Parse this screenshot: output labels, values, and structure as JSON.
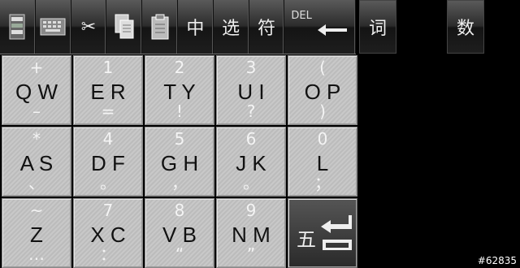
{
  "toolbar": {
    "buttons": [
      {
        "name": "select-all-icon",
        "label": ""
      },
      {
        "name": "keyboard-icon",
        "label": ""
      },
      {
        "name": "cut-icon",
        "label": "✂"
      },
      {
        "name": "copy-icon",
        "label": ""
      },
      {
        "name": "paste-icon",
        "label": ""
      },
      {
        "name": "chinese-mode-button",
        "label": "中"
      },
      {
        "name": "select-button",
        "label": "选"
      },
      {
        "name": "symbol-button",
        "label": "符"
      }
    ],
    "del_label": "DEL",
    "ci_label": "词",
    "shu_label": "数"
  },
  "keys": [
    {
      "top": "+",
      "main": "Q W",
      "bot": "–"
    },
    {
      "top": "1",
      "main": "E R",
      "bot": "="
    },
    {
      "top": "2",
      "main": "T Y",
      "bot": "!"
    },
    {
      "top": "3",
      "main": "U I",
      "bot": "?"
    },
    {
      "top": "(",
      "main": "O P",
      "bot": ")"
    },
    {
      "top": "*",
      "main": "A S",
      "bot": "、"
    },
    {
      "top": "4",
      "main": "D F",
      "bot": "。"
    },
    {
      "top": "5",
      "main": "G H",
      "bot": "，"
    },
    {
      "top": "6",
      "main": "J K",
      "bot": "。"
    },
    {
      "top": "0",
      "main": "L",
      "bot": "；"
    },
    {
      "top": "~",
      "main": "Z",
      "bot": "…"
    },
    {
      "top": "7",
      "main": "X C",
      "bot": "："
    },
    {
      "top": "8",
      "main": "V B",
      "bot": "“"
    },
    {
      "top": "9",
      "main": "N M",
      "bot": "”"
    }
  ],
  "enter": {
    "label": "五"
  },
  "watermark": "#62835"
}
